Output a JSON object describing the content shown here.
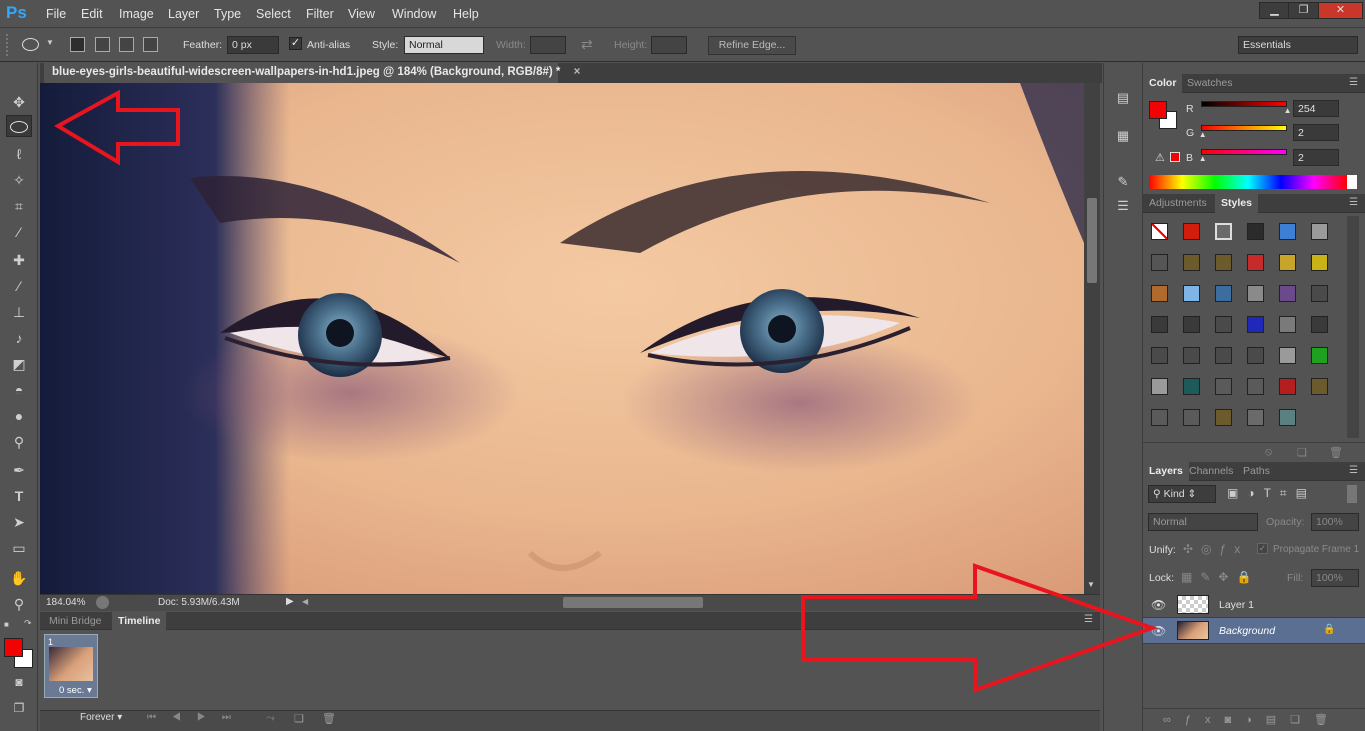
{
  "app": {
    "logo": "Ps"
  },
  "menu": [
    "File",
    "Edit",
    "Image",
    "Layer",
    "Type",
    "Select",
    "Filter",
    "View",
    "Window",
    "Help"
  ],
  "window_controls": {
    "minimize": "▁",
    "restore": "❐",
    "close": "✕"
  },
  "options": {
    "feather_label": "Feather:",
    "feather_value": "0 px",
    "antialias_label": "Anti-alias",
    "style_label": "Style:",
    "style_value": "Normal",
    "width_label": "Width:",
    "height_label": "Height:",
    "refine_label": "Refine Edge...",
    "workspace": "Essentials"
  },
  "document": {
    "tab_title": "blue-eyes-girls-beautiful-widescreen-wallpapers-in-hd1.jpeg @ 184% (Background, RGB/8#) *",
    "close": "×"
  },
  "status": {
    "zoom": "184.04%",
    "doc": "Doc: 5.93M/6.43M"
  },
  "timeline": {
    "tabs": [
      "Mini Bridge",
      "Timeline"
    ],
    "frame_number": "1",
    "frame_delay": "0 sec.",
    "loop": "Forever"
  },
  "color_panel": {
    "tabs": [
      "Color",
      "Swatches"
    ],
    "fg_color": "#f20202",
    "channels": [
      {
        "label": "R",
        "value": "254",
        "level": 0.996
      },
      {
        "label": "G",
        "value": "2",
        "level": 0.008
      },
      {
        "label": "B",
        "value": "2",
        "level": 0.008
      }
    ]
  },
  "styles_panel": {
    "tabs": [
      "Adjustments",
      "Styles"
    ],
    "style_colors": [
      "#ffffff",
      "#d21d0c",
      "#6a6a6a",
      "#2b2b2b",
      "#3e7fd6",
      "#9a9a9a",
      "#555555",
      "#6b5a2c",
      "#6b5a2c",
      "#c72a2a",
      "#c7a52a",
      "#c8b218",
      "#b06a2e",
      "#7fb4e6",
      "#3b6e9e",
      "#8a8a8a",
      "#6a4a8a",
      "#4a4a4a",
      "#3a3a3a",
      "#3a3a3a",
      "#4a4a4a",
      "#1f28b8",
      "#7a7a7a",
      "#3a3a3a",
      "#4a4a4a",
      "#4a4a4a",
      "#4a4a4a",
      "#4a4a4a",
      "#9a9a9a",
      "#1ea11e",
      "#9a9a9a",
      "#1e5a5a",
      "#5a5a5a",
      "#5a5a5a",
      "#b51e1e",
      "#6b5a2c",
      "#5a5a5a",
      "#5a5a5a",
      "#6b5a2c",
      "#6a6a6a",
      "#5a8080"
    ]
  },
  "layers_panel": {
    "tabs": [
      "Layers",
      "Channels",
      "Paths"
    ],
    "kind_label": "Kind",
    "blend_mode": "Normal",
    "opacity_label": "Opacity:",
    "opacity_value": "100%",
    "unify_label": "Unify:",
    "propagate_label": "Propagate Frame 1",
    "lock_label": "Lock:",
    "fill_label": "Fill:",
    "fill_value": "100%",
    "layers": [
      {
        "name": "Layer 1",
        "selected": false
      },
      {
        "name": "Background",
        "selected": true
      }
    ]
  },
  "annotation_color": "#e8141e"
}
